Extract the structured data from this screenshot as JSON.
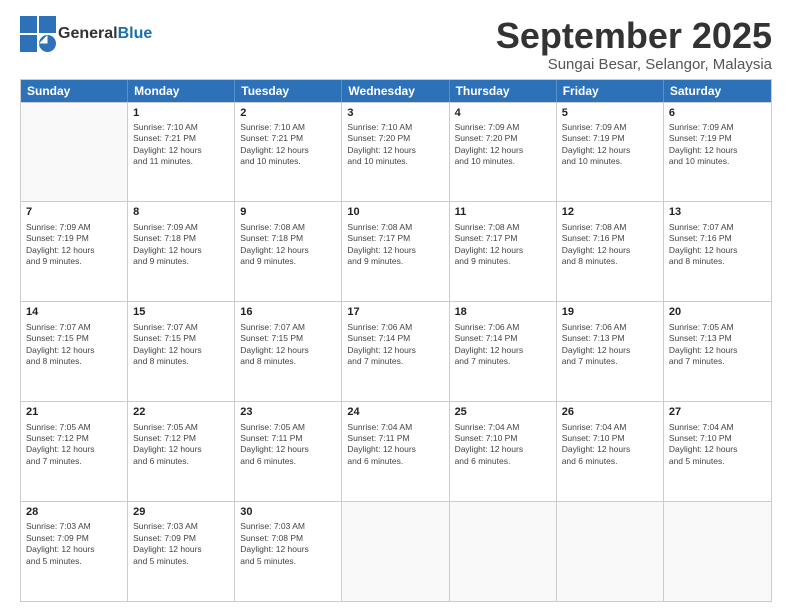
{
  "logo": {
    "general": "General",
    "blue": "Blue"
  },
  "title": "September 2025",
  "subtitle": "Sungai Besar, Selangor, Malaysia",
  "header_days": [
    "Sunday",
    "Monday",
    "Tuesday",
    "Wednesday",
    "Thursday",
    "Friday",
    "Saturday"
  ],
  "weeks": [
    [
      {
        "day": "",
        "info": ""
      },
      {
        "day": "1",
        "info": "Sunrise: 7:10 AM\nSunset: 7:21 PM\nDaylight: 12 hours\nand 11 minutes."
      },
      {
        "day": "2",
        "info": "Sunrise: 7:10 AM\nSunset: 7:21 PM\nDaylight: 12 hours\nand 10 minutes."
      },
      {
        "day": "3",
        "info": "Sunrise: 7:10 AM\nSunset: 7:20 PM\nDaylight: 12 hours\nand 10 minutes."
      },
      {
        "day": "4",
        "info": "Sunrise: 7:09 AM\nSunset: 7:20 PM\nDaylight: 12 hours\nand 10 minutes."
      },
      {
        "day": "5",
        "info": "Sunrise: 7:09 AM\nSunset: 7:19 PM\nDaylight: 12 hours\nand 10 minutes."
      },
      {
        "day": "6",
        "info": "Sunrise: 7:09 AM\nSunset: 7:19 PM\nDaylight: 12 hours\nand 10 minutes."
      }
    ],
    [
      {
        "day": "7",
        "info": "Sunrise: 7:09 AM\nSunset: 7:19 PM\nDaylight: 12 hours\nand 9 minutes."
      },
      {
        "day": "8",
        "info": "Sunrise: 7:09 AM\nSunset: 7:18 PM\nDaylight: 12 hours\nand 9 minutes."
      },
      {
        "day": "9",
        "info": "Sunrise: 7:08 AM\nSunset: 7:18 PM\nDaylight: 12 hours\nand 9 minutes."
      },
      {
        "day": "10",
        "info": "Sunrise: 7:08 AM\nSunset: 7:17 PM\nDaylight: 12 hours\nand 9 minutes."
      },
      {
        "day": "11",
        "info": "Sunrise: 7:08 AM\nSunset: 7:17 PM\nDaylight: 12 hours\nand 9 minutes."
      },
      {
        "day": "12",
        "info": "Sunrise: 7:08 AM\nSunset: 7:16 PM\nDaylight: 12 hours\nand 8 minutes."
      },
      {
        "day": "13",
        "info": "Sunrise: 7:07 AM\nSunset: 7:16 PM\nDaylight: 12 hours\nand 8 minutes."
      }
    ],
    [
      {
        "day": "14",
        "info": "Sunrise: 7:07 AM\nSunset: 7:15 PM\nDaylight: 12 hours\nand 8 minutes."
      },
      {
        "day": "15",
        "info": "Sunrise: 7:07 AM\nSunset: 7:15 PM\nDaylight: 12 hours\nand 8 minutes."
      },
      {
        "day": "16",
        "info": "Sunrise: 7:07 AM\nSunset: 7:15 PM\nDaylight: 12 hours\nand 8 minutes."
      },
      {
        "day": "17",
        "info": "Sunrise: 7:06 AM\nSunset: 7:14 PM\nDaylight: 12 hours\nand 7 minutes."
      },
      {
        "day": "18",
        "info": "Sunrise: 7:06 AM\nSunset: 7:14 PM\nDaylight: 12 hours\nand 7 minutes."
      },
      {
        "day": "19",
        "info": "Sunrise: 7:06 AM\nSunset: 7:13 PM\nDaylight: 12 hours\nand 7 minutes."
      },
      {
        "day": "20",
        "info": "Sunrise: 7:05 AM\nSunset: 7:13 PM\nDaylight: 12 hours\nand 7 minutes."
      }
    ],
    [
      {
        "day": "21",
        "info": "Sunrise: 7:05 AM\nSunset: 7:12 PM\nDaylight: 12 hours\nand 7 minutes."
      },
      {
        "day": "22",
        "info": "Sunrise: 7:05 AM\nSunset: 7:12 PM\nDaylight: 12 hours\nand 6 minutes."
      },
      {
        "day": "23",
        "info": "Sunrise: 7:05 AM\nSunset: 7:11 PM\nDaylight: 12 hours\nand 6 minutes."
      },
      {
        "day": "24",
        "info": "Sunrise: 7:04 AM\nSunset: 7:11 PM\nDaylight: 12 hours\nand 6 minutes."
      },
      {
        "day": "25",
        "info": "Sunrise: 7:04 AM\nSunset: 7:10 PM\nDaylight: 12 hours\nand 6 minutes."
      },
      {
        "day": "26",
        "info": "Sunrise: 7:04 AM\nSunset: 7:10 PM\nDaylight: 12 hours\nand 6 minutes."
      },
      {
        "day": "27",
        "info": "Sunrise: 7:04 AM\nSunset: 7:10 PM\nDaylight: 12 hours\nand 5 minutes."
      }
    ],
    [
      {
        "day": "28",
        "info": "Sunrise: 7:03 AM\nSunset: 7:09 PM\nDaylight: 12 hours\nand 5 minutes."
      },
      {
        "day": "29",
        "info": "Sunrise: 7:03 AM\nSunset: 7:09 PM\nDaylight: 12 hours\nand 5 minutes."
      },
      {
        "day": "30",
        "info": "Sunrise: 7:03 AM\nSunset: 7:08 PM\nDaylight: 12 hours\nand 5 minutes."
      },
      {
        "day": "",
        "info": ""
      },
      {
        "day": "",
        "info": ""
      },
      {
        "day": "",
        "info": ""
      },
      {
        "day": "",
        "info": ""
      }
    ]
  ]
}
